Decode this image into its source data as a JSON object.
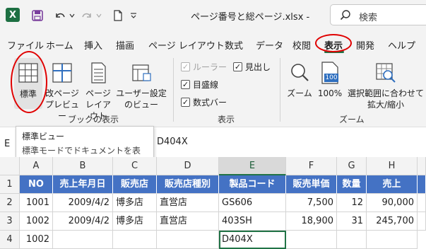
{
  "titlebar": {
    "app_logo": "X",
    "doc_title": "ページ番号と総ページ.xlsx  -",
    "search_placeholder": "検索",
    "icons": [
      "save-icon",
      "undo-icon",
      "redo-icon",
      "new-file-icon",
      "customize-icon"
    ]
  },
  "menu": [
    "ファイル",
    "ホーム",
    "挿入",
    "描画",
    "ページ レイアウト",
    "数式",
    "データ",
    "校閲",
    "表示",
    "開発",
    "ヘルプ"
  ],
  "active_menu": "表示",
  "ribbon": {
    "book_views": {
      "label": "ブックの表示",
      "normal": "標準",
      "page_break_1": "改ページ",
      "page_break_2": "プレビュー",
      "page_layout_1": "ページ",
      "page_layout_2": "レイアウト",
      "custom_1": "ユーザー設定",
      "custom_2": "のビュー"
    },
    "show": {
      "label": "表示",
      "ruler": "ルーラー",
      "headings": "見出し",
      "gridlines": "目盛線",
      "formula_bar": "数式バー"
    },
    "zoom": {
      "label": "ズーム",
      "zoom": "ズーム",
      "pct100": "100%",
      "pct_icon": "100",
      "fit_1": "選択範囲に合わせて",
      "fit_2": "拡大/縮小"
    }
  },
  "formula": {
    "name_stub": "E",
    "content": "D404X"
  },
  "tooltip": {
    "title": "標準ビュー",
    "body": "標準モードでドキュメントを表示します。"
  },
  "columns": [
    "A",
    "B",
    "C",
    "D",
    "E",
    "F",
    "G",
    "H"
  ],
  "selected_column": "E",
  "rows": [
    {
      "num": "1",
      "cells": [
        "NO",
        "売上年月日",
        "販売店",
        "販売店種別",
        "製品コード",
        "販売単価",
        "数量",
        "売上"
      ]
    },
    {
      "num": "2",
      "cells": [
        "1001",
        "2009/4/2",
        "博多店",
        "直営店",
        "GS606",
        "7,500",
        "12",
        "90,000"
      ]
    },
    {
      "num": "3",
      "cells": [
        "1002",
        "2009/4/2",
        "博多店",
        "直営店",
        "403SH",
        "18,900",
        "31",
        "245,700"
      ]
    },
    {
      "num": "4",
      "cells": [
        "1002",
        "",
        "",
        "",
        "D404X",
        "",
        "",
        ""
      ]
    }
  ],
  "colors": {
    "accent": "#217346",
    "header_fill": "#4472c4",
    "annotation": "#e00000"
  }
}
